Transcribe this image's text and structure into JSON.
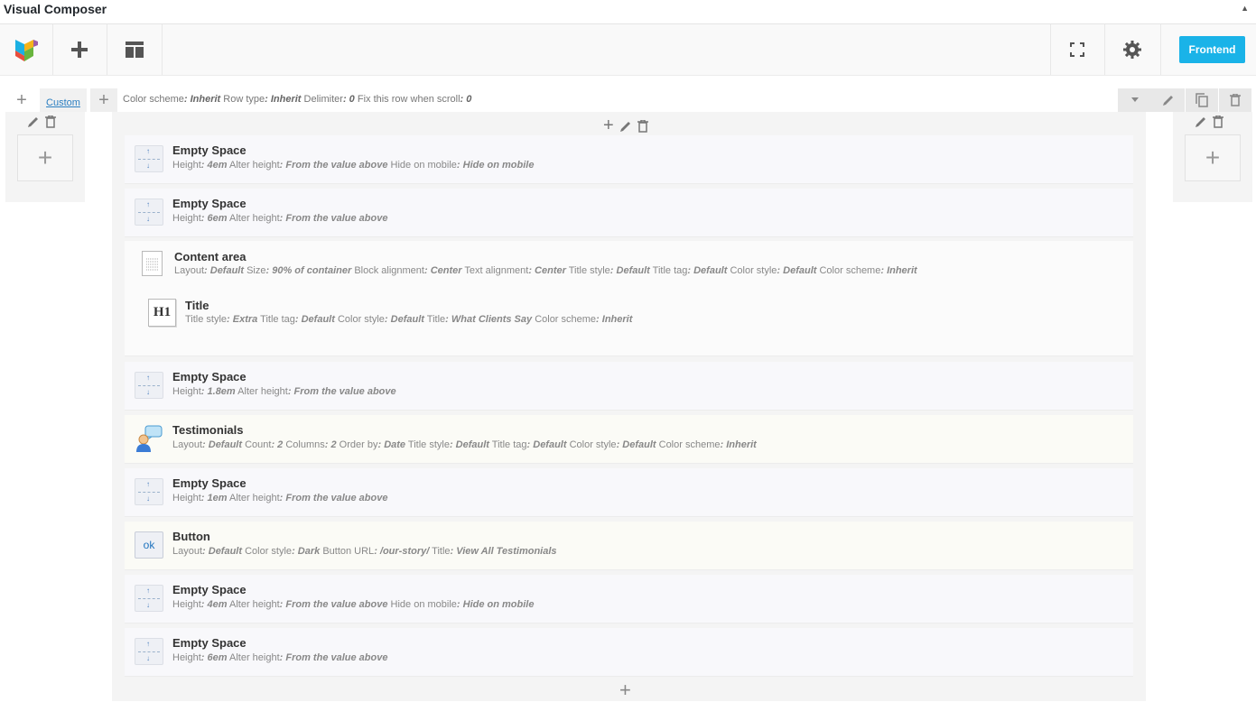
{
  "window": {
    "title": "Visual Composer",
    "collapse_glyph": "▲"
  },
  "toolbar": {
    "logo_icon": "vc-logo-icon",
    "add_icon": "plus-icon",
    "templates_icon": "layout-icon",
    "fullscreen_icon": "fullscreen-icon",
    "settings_icon": "gear-icon",
    "frontend_label": "Frontend",
    "accent": "#1ab3e8"
  },
  "row": {
    "custom_label": "Custom",
    "params": [
      {
        "label": "Color scheme",
        "value": ": Inherit"
      },
      {
        "label": "Row type",
        "value": ": Inherit"
      },
      {
        "label": "Delimiter",
        "value": ": 0"
      },
      {
        "label": "Fix this row when scroll",
        "value": ": 0"
      }
    ]
  },
  "elements": [
    {
      "name": "Empty Space",
      "params": [
        {
          "label": "Height",
          "value": ": 4em"
        },
        {
          "label": "Alter height",
          "value": ": From the value above"
        },
        {
          "label": "Hide on mobile",
          "value": ": Hide on mobile"
        }
      ]
    },
    {
      "name": "Empty Space",
      "params": [
        {
          "label": "Height",
          "value": ": 6em"
        },
        {
          "label": "Alter height",
          "value": ": From the value above"
        }
      ]
    },
    {
      "name": "Content area",
      "params": [
        {
          "label": "Layout",
          "value": ": Default"
        },
        {
          "label": "Size",
          "value": ": 90% of container"
        },
        {
          "label": "Block alignment",
          "value": ": Center"
        },
        {
          "label": "Text alignment",
          "value": ": Center"
        },
        {
          "label": "Title style",
          "value": ": Default"
        },
        {
          "label": "Title tag",
          "value": ": Default"
        },
        {
          "label": "Color style",
          "value": ": Default"
        },
        {
          "label": "Color scheme",
          "value": ": Inherit"
        }
      ]
    },
    {
      "name": "Title",
      "params": [
        {
          "label": "Title style",
          "value": ": Extra"
        },
        {
          "label": "Title tag",
          "value": ": Default"
        },
        {
          "label": "Color style",
          "value": ": Default"
        },
        {
          "label": "Title",
          "value": ": What Clients Say"
        },
        {
          "label": "Color scheme",
          "value": ": Inherit"
        }
      ]
    },
    {
      "name": "Empty Space",
      "params": [
        {
          "label": "Height",
          "value": ": 1.8em"
        },
        {
          "label": "Alter height",
          "value": ": From the value above"
        }
      ]
    },
    {
      "name": "Testimonials",
      "params": [
        {
          "label": "Layout",
          "value": ": Default"
        },
        {
          "label": "Count",
          "value": ": 2"
        },
        {
          "label": "Columns",
          "value": ": 2"
        },
        {
          "label": "Order by",
          "value": ": Date"
        },
        {
          "label": "Title style",
          "value": ": Default"
        },
        {
          "label": "Title tag",
          "value": ": Default"
        },
        {
          "label": "Color style",
          "value": ": Default"
        },
        {
          "label": "Color scheme",
          "value": ": Inherit"
        }
      ]
    },
    {
      "name": "Empty Space",
      "params": [
        {
          "label": "Height",
          "value": ": 1em"
        },
        {
          "label": "Alter height",
          "value": ": From the value above"
        }
      ]
    },
    {
      "name": "Button",
      "icon_text": "ok",
      "params": [
        {
          "label": "Layout",
          "value": ": Default"
        },
        {
          "label": "Color style",
          "value": ": Dark"
        },
        {
          "label": "Button URL",
          "value": ": /our-story/"
        },
        {
          "label": "Title",
          "value": ": View All Testimonials"
        }
      ]
    },
    {
      "name": "Empty Space",
      "params": [
        {
          "label": "Height",
          "value": ": 4em"
        },
        {
          "label": "Alter height",
          "value": ": From the value above"
        },
        {
          "label": "Hide on mobile",
          "value": ": Hide on mobile"
        }
      ]
    },
    {
      "name": "Empty Space",
      "params": [
        {
          "label": "Height",
          "value": ": 6em"
        },
        {
          "label": "Alter height",
          "value": ": From the value above"
        }
      ]
    }
  ]
}
